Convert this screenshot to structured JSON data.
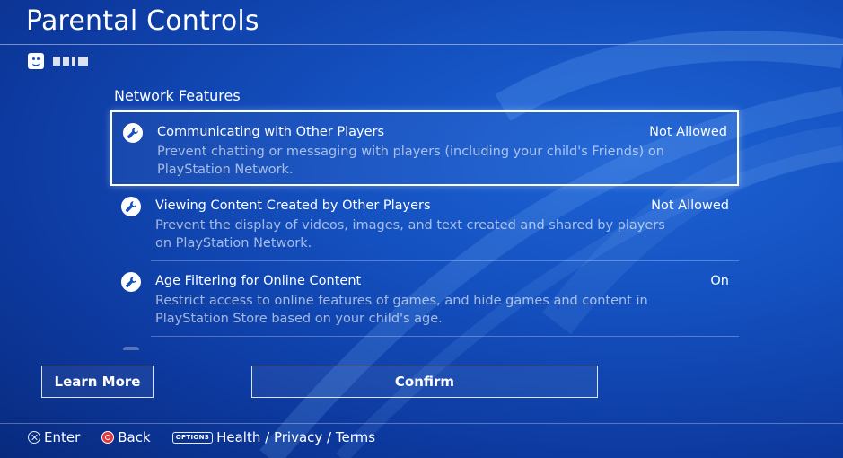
{
  "header": {
    "title": "Parental Controls"
  },
  "user": {
    "avatar_icon": "smiley-face-icon"
  },
  "section": {
    "heading": "Network Features"
  },
  "settings": [
    {
      "title": "Communicating with Other Players",
      "description": "Prevent chatting or messaging with players (including your child's Friends) on PlayStation Network.",
      "value": "Not Allowed",
      "icon": "wrench-icon",
      "focused": true
    },
    {
      "title": "Viewing Content Created by Other Players",
      "description": "Prevent the display of videos, images, and text created and shared by players on PlayStation Network.",
      "value": "Not Allowed",
      "icon": "wrench-icon",
      "focused": false
    },
    {
      "title": "Age Filtering for Online Content",
      "description": "Restrict access to online features of games, and hide games and content in PlayStation Store based on your child's age.",
      "value": "On",
      "icon": "wrench-icon",
      "focused": false
    }
  ],
  "buttons": {
    "learn_more": "Learn More",
    "confirm": "Confirm"
  },
  "footer": {
    "enter_label": "Enter",
    "back_label": "Back",
    "options_badge": "OPTIONS",
    "links_label": "Health / Privacy / Terms"
  },
  "colors": {
    "background": "#1450bf",
    "text": "#ffffff",
    "description_text": "#a9bde6",
    "circle_button": "#e23a3a"
  }
}
